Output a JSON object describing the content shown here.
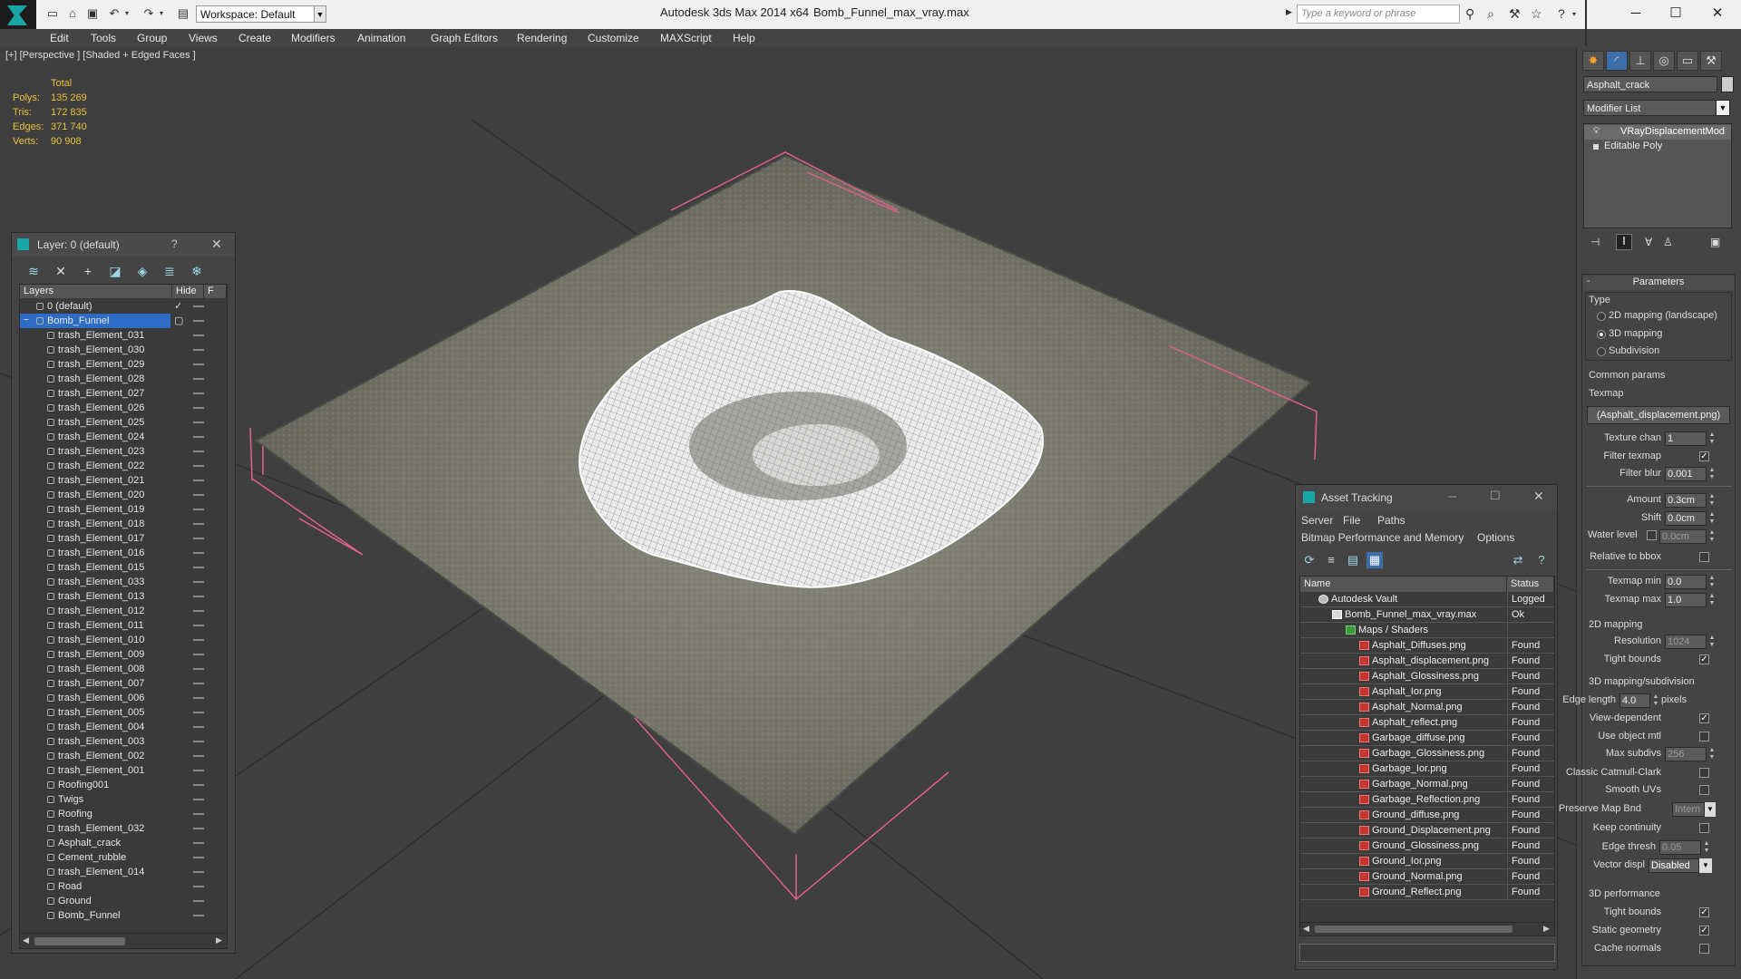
{
  "titlebar": {
    "workspace": "Workspace: Default",
    "app_title": "Autodesk 3ds Max  2014 x64",
    "file_title": "Bomb_Funnel_max_vray.max",
    "search_placeholder": "Type a keyword or phrase"
  },
  "menu": [
    "Edit",
    "Tools",
    "Group",
    "Views",
    "Create",
    "Modifiers",
    "Animation",
    "Graph Editors",
    "Rendering",
    "Customize",
    "MAXScript",
    "Help"
  ],
  "viewport": {
    "label": "[+] [Perspective ] [Shaded + Edged Faces ]",
    "stats": {
      "header": "Total",
      "rows": [
        {
          "label": "Polys:",
          "value": "135 269"
        },
        {
          "label": "Tris:",
          "value": "172 835"
        },
        {
          "label": "Edges:",
          "value": "371 740"
        },
        {
          "label": "Verts:",
          "value": "90 908"
        }
      ]
    }
  },
  "layer_panel": {
    "title": "Layer: 0 (default)",
    "help": "?",
    "close": "✕",
    "col_layers": "Layers",
    "col_hide": "Hide",
    "col_f": "F",
    "rows": [
      {
        "name": "0 (default)",
        "level": 0,
        "check": "✓"
      },
      {
        "name": "Bomb_Funnel",
        "level": 0,
        "selected": true,
        "check": "▢"
      },
      {
        "name": "trash_Element_031",
        "level": 1
      },
      {
        "name": "trash_Element_030",
        "level": 1
      },
      {
        "name": "trash_Element_029",
        "level": 1
      },
      {
        "name": "trash_Element_028",
        "level": 1
      },
      {
        "name": "trash_Element_027",
        "level": 1
      },
      {
        "name": "trash_Element_026",
        "level": 1
      },
      {
        "name": "trash_Element_025",
        "level": 1
      },
      {
        "name": "trash_Element_024",
        "level": 1
      },
      {
        "name": "trash_Element_023",
        "level": 1
      },
      {
        "name": "trash_Element_022",
        "level": 1
      },
      {
        "name": "trash_Element_021",
        "level": 1
      },
      {
        "name": "trash_Element_020",
        "level": 1
      },
      {
        "name": "trash_Element_019",
        "level": 1
      },
      {
        "name": "trash_Element_018",
        "level": 1
      },
      {
        "name": "trash_Element_017",
        "level": 1
      },
      {
        "name": "trash_Element_016",
        "level": 1
      },
      {
        "name": "trash_Element_015",
        "level": 1
      },
      {
        "name": "trash_Element_033",
        "level": 1
      },
      {
        "name": "trash_Element_013",
        "level": 1
      },
      {
        "name": "trash_Element_012",
        "level": 1
      },
      {
        "name": "trash_Element_011",
        "level": 1
      },
      {
        "name": "trash_Element_010",
        "level": 1
      },
      {
        "name": "trash_Element_009",
        "level": 1
      },
      {
        "name": "trash_Element_008",
        "level": 1
      },
      {
        "name": "trash_Element_007",
        "level": 1
      },
      {
        "name": "trash_Element_006",
        "level": 1
      },
      {
        "name": "trash_Element_005",
        "level": 1
      },
      {
        "name": "trash_Element_004",
        "level": 1
      },
      {
        "name": "trash_Element_003",
        "level": 1
      },
      {
        "name": "trash_Element_002",
        "level": 1
      },
      {
        "name": "trash_Element_001",
        "level": 1
      },
      {
        "name": "Roofing001",
        "level": 1
      },
      {
        "name": "Twigs",
        "level": 1
      },
      {
        "name": "Roofing",
        "level": 1
      },
      {
        "name": "trash_Element_032",
        "level": 1
      },
      {
        "name": "Asphalt_crack",
        "level": 1
      },
      {
        "name": "Cement_rubble",
        "level": 1
      },
      {
        "name": "trash_Element_014",
        "level": 1
      },
      {
        "name": "Road",
        "level": 1
      },
      {
        "name": "Ground",
        "level": 1
      },
      {
        "name": "Bomb_Funnel",
        "level": 1
      }
    ]
  },
  "asset_panel": {
    "title": "Asset Tracking",
    "menu1": [
      "Server",
      "File",
      "Paths"
    ],
    "menu2": [
      "Bitmap Performance and Memory",
      "Options"
    ],
    "col_name": "Name",
    "col_status": "Status",
    "rows": [
      {
        "name": "Autodesk Vault",
        "status": "Logged",
        "level": 0,
        "type": "vault"
      },
      {
        "name": "Bomb_Funnel_max_vray.max",
        "status": "Ok",
        "level": 1,
        "type": "max"
      },
      {
        "name": "Maps / Shaders",
        "status": "",
        "level": 2,
        "type": "folder"
      },
      {
        "name": "Asphalt_Diffuses.png",
        "status": "Found",
        "level": 3,
        "type": "png"
      },
      {
        "name": "Asphalt_displacement.png",
        "status": "Found",
        "level": 3,
        "type": "png"
      },
      {
        "name": "Asphalt_Glossiness.png",
        "status": "Found",
        "level": 3,
        "type": "png"
      },
      {
        "name": "Asphalt_Ior.png",
        "status": "Found",
        "level": 3,
        "type": "png"
      },
      {
        "name": "Asphalt_Normal.png",
        "status": "Found",
        "level": 3,
        "type": "png"
      },
      {
        "name": "Asphalt_reflect.png",
        "status": "Found",
        "level": 3,
        "type": "png"
      },
      {
        "name": "Garbage_diffuse.png",
        "status": "Found",
        "level": 3,
        "type": "png"
      },
      {
        "name": "Garbage_Glossiness.png",
        "status": "Found",
        "level": 3,
        "type": "png"
      },
      {
        "name": "Garbage_Ior.png",
        "status": "Found",
        "level": 3,
        "type": "png"
      },
      {
        "name": "Garbage_Normal.png",
        "status": "Found",
        "level": 3,
        "type": "png"
      },
      {
        "name": "Garbage_Reflection.png",
        "status": "Found",
        "level": 3,
        "type": "png"
      },
      {
        "name": "Ground_diffuse.png",
        "status": "Found",
        "level": 3,
        "type": "png"
      },
      {
        "name": "Ground_Displacement.png",
        "status": "Found",
        "level": 3,
        "type": "png"
      },
      {
        "name": "Ground_Glossiness.png",
        "status": "Found",
        "level": 3,
        "type": "png"
      },
      {
        "name": "Ground_Ior.png",
        "status": "Found",
        "level": 3,
        "type": "png"
      },
      {
        "name": "Ground_Normal.png",
        "status": "Found",
        "level": 3,
        "type": "png"
      },
      {
        "name": "Ground_Reflect.png",
        "status": "Found",
        "level": 3,
        "type": "png"
      }
    ]
  },
  "command_panel": {
    "object_name": "Asphalt_crack",
    "modifier_list": "Modifier List",
    "stack": [
      "VRayDisplacementMod",
      "Editable Poly"
    ],
    "rollout_title": "Parameters",
    "type_label": "Type",
    "type_options": [
      "2D mapping (landscape)",
      "3D mapping",
      "Subdivision"
    ],
    "common_params": "Common params",
    "texmap_label": "Texmap",
    "texmap_value": "(Asphalt_displacement.png)",
    "fields": {
      "texture_chan": {
        "label": "Texture chan",
        "value": "1"
      },
      "filter_texmap": {
        "label": "Filter texmap",
        "checked": "✓"
      },
      "filter_blur": {
        "label": "Filter blur",
        "value": "0.001"
      },
      "amount": {
        "label": "Amount",
        "value": "0.3cm"
      },
      "shift": {
        "label": "Shift",
        "value": "0.0cm"
      },
      "water_level": {
        "label": "Water level",
        "value": "0.0cm"
      },
      "relative_bbox": {
        "label": "Relative to bbox"
      },
      "texmap_min": {
        "label": "Texmap min",
        "value": "0.0"
      },
      "texmap_max": {
        "label": "Texmap max",
        "value": "1.0"
      }
    },
    "mapping2d_title": "2D mapping",
    "resolution": {
      "label": "Resolution",
      "value": "1024"
    },
    "tight_bounds_2d": {
      "label": "Tight bounds",
      "checked": "✓"
    },
    "mapping3d_title": "3D mapping/subdivision",
    "edge_length": {
      "label": "Edge length",
      "value": "4.0",
      "unit": "pixels"
    },
    "view_dependent": {
      "label": "View-dependent",
      "checked": "✓"
    },
    "use_object_mtl": {
      "label": "Use object mtl"
    },
    "max_subdivs": {
      "label": "Max subdivs",
      "value": "256"
    },
    "classic_catmull": {
      "label": "Classic Catmull-Clark"
    },
    "smooth_uvs": {
      "label": "Smooth UVs"
    },
    "preserve_map_bnd": {
      "label": "Preserve Map Bnd",
      "value": "Intern"
    },
    "keep_continuity": {
      "label": "Keep continuity"
    },
    "edge_thresh": {
      "label": "Edge thresh",
      "value": "0.05"
    },
    "vector_displ": {
      "label": "Vector displ",
      "value": "Disabled"
    },
    "perf_title": "3D performance",
    "tight_bounds_3d": {
      "label": "Tight bounds",
      "checked": "✓"
    },
    "static_geometry": {
      "label": "Static geometry",
      "checked": "✓"
    },
    "cache_normals": {
      "label": "Cache normals"
    }
  }
}
